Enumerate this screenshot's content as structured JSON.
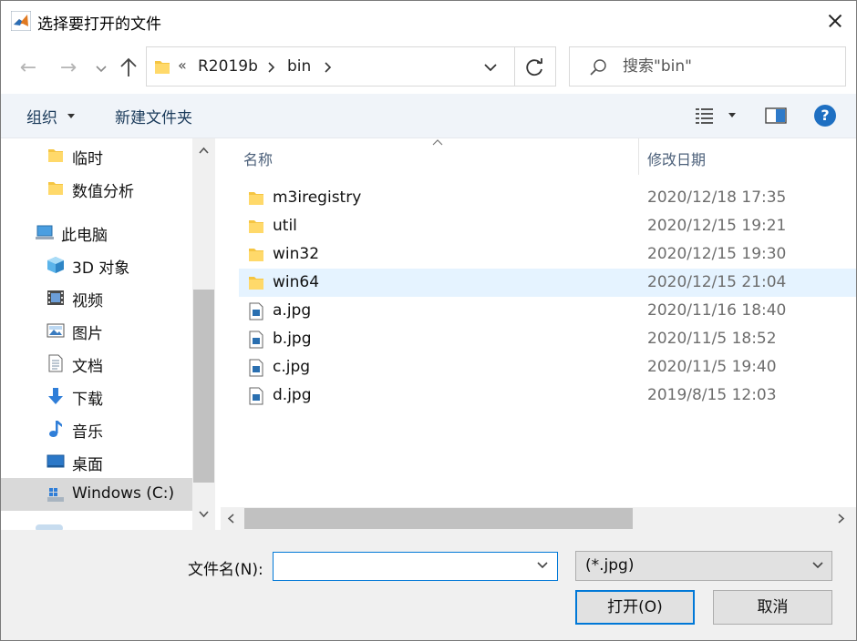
{
  "window": {
    "title": "选择要打开的文件"
  },
  "nav": {
    "back_glyph": "←",
    "forward_glyph": "→"
  },
  "address": {
    "overflow": "«",
    "crumbs": [
      "R2019b",
      "bin"
    ]
  },
  "search": {
    "placeholder": "搜索\"bin\""
  },
  "toolbar": {
    "organize_label": "组织",
    "new_folder_label": "新建文件夹",
    "help_glyph": "?"
  },
  "sidebar": {
    "items": [
      {
        "label": "临时",
        "icon": "folder-icon"
      },
      {
        "label": "数值分析",
        "icon": "folder-icon"
      },
      {
        "label": "此电脑",
        "icon": "computer-icon"
      },
      {
        "label": "3D 对象",
        "icon": "cube-icon"
      },
      {
        "label": "视频",
        "icon": "video-icon"
      },
      {
        "label": "图片",
        "icon": "pictures-icon"
      },
      {
        "label": "文档",
        "icon": "document-icon"
      },
      {
        "label": "下载",
        "icon": "download-icon"
      },
      {
        "label": "音乐",
        "icon": "music-icon"
      },
      {
        "label": "桌面",
        "icon": "desktop-icon"
      },
      {
        "label": "Windows (C:)",
        "icon": "drive-icon"
      }
    ]
  },
  "filelist": {
    "columns": [
      "名称",
      "修改日期"
    ],
    "rows": [
      {
        "name": "m3iregistry",
        "date": "2020/12/18 17:35",
        "type": "folder"
      },
      {
        "name": "util",
        "date": "2020/12/15 19:21",
        "type": "folder"
      },
      {
        "name": "win32",
        "date": "2020/12/15 19:30",
        "type": "folder"
      },
      {
        "name": "win64",
        "date": "2020/12/15 21:04",
        "type": "folder"
      },
      {
        "name": "a.jpg",
        "date": "2020/11/16 18:40",
        "type": "image"
      },
      {
        "name": "b.jpg",
        "date": "2020/11/5 18:52",
        "type": "image"
      },
      {
        "name": "c.jpg",
        "date": "2020/11/5 19:40",
        "type": "image"
      },
      {
        "name": "d.jpg",
        "date": "2019/8/15 12:03",
        "type": "image"
      }
    ]
  },
  "footer": {
    "filename_label": "文件名(N):",
    "filename_value": "",
    "filter_value": "(*.jpg)",
    "open_label": "打开(O)",
    "cancel_label": "取消"
  },
  "colors": {
    "accent": "#0078d7",
    "folder": "#f5c542",
    "selection_row": "#e5f3ff",
    "sidebar_selected": "#d9d9d9"
  }
}
